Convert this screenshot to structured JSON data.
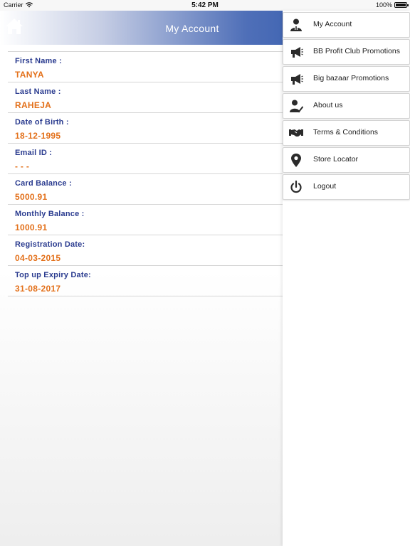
{
  "status_bar": {
    "carrier": "Carrier",
    "time": "5:42 PM",
    "battery": "100%"
  },
  "header": {
    "title": "My Account"
  },
  "fields": [
    {
      "label": "First Name :",
      "value": "TANYA"
    },
    {
      "label": "Last Name :",
      "value": "RAHEJA"
    },
    {
      "label": "Date of Birth :",
      "value": "18-12-1995"
    },
    {
      "label": "Email ID :",
      "value": "- - -"
    },
    {
      "label": "Card Balance :",
      "value": "5000.91"
    },
    {
      "label": "Monthly Balance :",
      "value": "1000.91"
    },
    {
      "label": "Registration Date:",
      "value": "04-03-2015"
    },
    {
      "label": "Top up Expiry Date:",
      "value": "31-08-2017"
    }
  ],
  "menu": {
    "items": [
      {
        "label": "My Account",
        "icon": "user-account-icon"
      },
      {
        "label": "BB Profit Club Promotions",
        "icon": "megaphone-icon"
      },
      {
        "label": "Big bazaar Promotions",
        "icon": "megaphone-icon"
      },
      {
        "label": "About us",
        "icon": "user-check-icon"
      },
      {
        "label": "Terms & Conditions",
        "icon": "handshake-icon"
      },
      {
        "label": "Store Locator",
        "icon": "map-pin-icon"
      },
      {
        "label": "Logout",
        "icon": "power-icon"
      }
    ]
  },
  "colors": {
    "label": "#2a3b8f",
    "value": "#e3701a",
    "header_blue": "#1f4ea6"
  }
}
